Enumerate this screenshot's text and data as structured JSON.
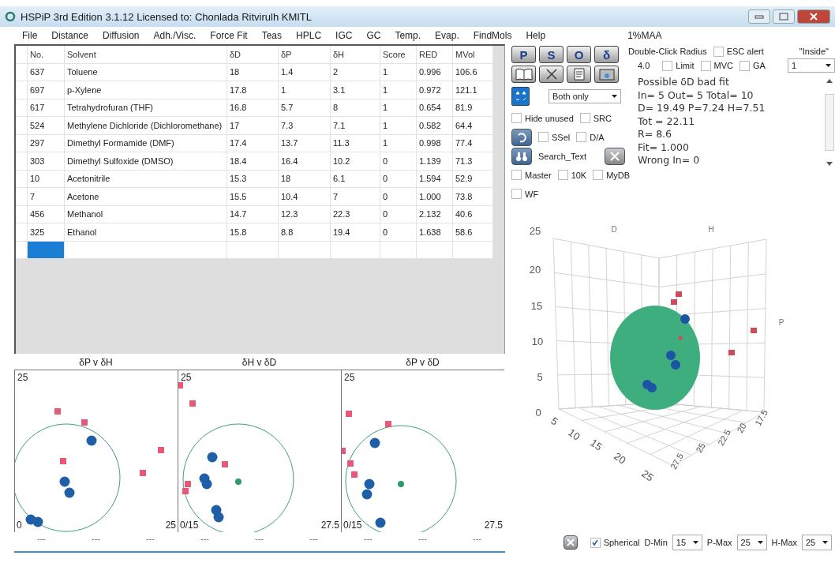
{
  "window": {
    "title": "HSPiP 3rd Edition 3.1.12 Licensed to: Chonlada Ritvirulh KMITL"
  },
  "menu": [
    "File",
    "Distance",
    "Diffusion",
    "Adh./Visc.",
    "Force Fit",
    "Teas",
    "HPLC",
    "IGC",
    "GC",
    "Temp.",
    "Evap.",
    "FindMols",
    "Help"
  ],
  "project_label": "1%MAA",
  "table": {
    "columns": [
      "No.",
      "Solvent",
      "δD",
      "δP",
      "δH",
      "Score",
      "RED",
      "MVol"
    ],
    "rows": [
      [
        "637",
        "Toluene",
        "18",
        "1.4",
        "2",
        "1",
        "0.996",
        "106.6"
      ],
      [
        "697",
        "p-Xylene",
        "17.8",
        "1",
        "3.1",
        "1",
        "0.972",
        "121.1"
      ],
      [
        "617",
        "Tetrahydrofuran (THF)",
        "16.8",
        "5.7",
        "8",
        "1",
        "0.654",
        "81.9"
      ],
      [
        "524",
        "Methylene Dichloride (Dichloromethane)",
        "17",
        "7.3",
        "7.1",
        "1",
        "0.582",
        "64.4"
      ],
      [
        "297",
        "Dimethyl Formamide (DMF)",
        "17.4",
        "13.7",
        "11.3",
        "1",
        "0.998",
        "77.4"
      ],
      [
        "303",
        "Dimethyl Sulfoxide (DMSO)",
        "18.4",
        "16.4",
        "10.2",
        "0",
        "1.139",
        "71.3"
      ],
      [
        "10",
        "Acetonitrile",
        "15.3",
        "18",
        "6.1",
        "0",
        "1.594",
        "52.9"
      ],
      [
        "7",
        "Acetone",
        "15.5",
        "10.4",
        "7",
        "0",
        "1.000",
        "73.8"
      ],
      [
        "456",
        "Methanol",
        "14.7",
        "12.3",
        "22.3",
        "0",
        "2.132",
        "40.6"
      ],
      [
        "325",
        "Ethanol",
        "15.8",
        "8.8",
        "19.4",
        "0",
        "1.638",
        "58.6"
      ]
    ],
    "new_row_selected": true
  },
  "tool_buttons": [
    "P",
    "S",
    "O",
    "δ"
  ],
  "display_select": {
    "value": "Both only"
  },
  "options_row_1": [
    {
      "label": "Hide unused",
      "checked": false
    },
    {
      "label": "SRC",
      "checked": false
    }
  ],
  "options_row_2": [
    {
      "label": "SSel",
      "checked": false
    },
    {
      "label": "D/A",
      "checked": false
    }
  ],
  "search_button": {
    "label": "Search_Text"
  },
  "options_row_3": [
    {
      "label": "Master",
      "checked": false
    },
    {
      "label": "10K",
      "checked": false
    },
    {
      "label": "MyDB",
      "checked": false
    }
  ],
  "options_row_4": [
    {
      "label": "WF",
      "checked": false
    }
  ],
  "radius": {
    "label": "Double-Click Radius",
    "value": "4.0"
  },
  "esc_alert": {
    "label": "ESC alert",
    "checked": false
  },
  "radius_options": [
    {
      "label": "Limit",
      "checked": false
    },
    {
      "label": "MVC",
      "checked": false
    },
    {
      "label": "GA",
      "checked": false
    }
  ],
  "inside": {
    "label": "\"Inside\"",
    "value": "1"
  },
  "results": [
    "Possible δD bad fit",
    "In= 5 Out= 5 Total= 10",
    "D= 19.49 P=7.24 H=7.51",
    "Tot = 22.11",
    "R= 8.6",
    "Fit= 1.000",
    "Wrong In= 0"
  ],
  "plots_2d": [
    {
      "title": "δP v δH",
      "y_max": "25",
      "x_min": "0",
      "x_max": "25",
      "footer": [
        "---",
        "---",
        "---"
      ]
    },
    {
      "title": "δH v δD",
      "y_max": "25",
      "x_min": "0/15",
      "x_max": "27.5",
      "footer": [
        "---",
        "---",
        "---"
      ]
    },
    {
      "title": "δP v δD",
      "y_max": "25",
      "x_min": "0/15",
      "x_max": "27.5",
      "footer": [
        "---",
        "---",
        "---"
      ]
    }
  ],
  "plot_3d": {
    "axis_labels": [
      "D",
      "H",
      "P"
    ],
    "vertical_ticks": [
      "25",
      "20",
      "15",
      "10",
      "5",
      "0"
    ],
    "front_ticks": [
      "5",
      "10",
      "15",
      "20",
      "25"
    ],
    "side_ticks": [
      "27.5",
      "25",
      "22.5",
      "20",
      "17.5"
    ]
  },
  "bottom_controls": {
    "spherical": {
      "label": "Spherical",
      "checked": true
    },
    "d_min": {
      "label": "D-Min",
      "value": "15"
    },
    "p_max": {
      "label": "P-Max",
      "value": "25"
    },
    "h_max": {
      "label": "H-Max",
      "value": "25"
    }
  }
}
